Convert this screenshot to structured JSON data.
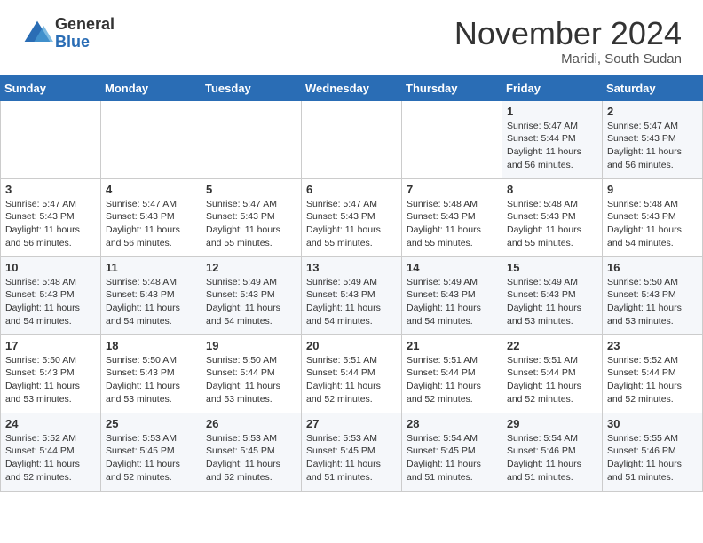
{
  "header": {
    "logo_general": "General",
    "logo_blue": "Blue",
    "month_title": "November 2024",
    "location": "Maridi, South Sudan"
  },
  "weekdays": [
    "Sunday",
    "Monday",
    "Tuesday",
    "Wednesday",
    "Thursday",
    "Friday",
    "Saturday"
  ],
  "weeks": [
    [
      {
        "day": "",
        "info": ""
      },
      {
        "day": "",
        "info": ""
      },
      {
        "day": "",
        "info": ""
      },
      {
        "day": "",
        "info": ""
      },
      {
        "day": "",
        "info": ""
      },
      {
        "day": "1",
        "info": "Sunrise: 5:47 AM\nSunset: 5:44 PM\nDaylight: 11 hours\nand 56 minutes."
      },
      {
        "day": "2",
        "info": "Sunrise: 5:47 AM\nSunset: 5:43 PM\nDaylight: 11 hours\nand 56 minutes."
      }
    ],
    [
      {
        "day": "3",
        "info": "Sunrise: 5:47 AM\nSunset: 5:43 PM\nDaylight: 11 hours\nand 56 minutes."
      },
      {
        "day": "4",
        "info": "Sunrise: 5:47 AM\nSunset: 5:43 PM\nDaylight: 11 hours\nand 56 minutes."
      },
      {
        "day": "5",
        "info": "Sunrise: 5:47 AM\nSunset: 5:43 PM\nDaylight: 11 hours\nand 55 minutes."
      },
      {
        "day": "6",
        "info": "Sunrise: 5:47 AM\nSunset: 5:43 PM\nDaylight: 11 hours\nand 55 minutes."
      },
      {
        "day": "7",
        "info": "Sunrise: 5:48 AM\nSunset: 5:43 PM\nDaylight: 11 hours\nand 55 minutes."
      },
      {
        "day": "8",
        "info": "Sunrise: 5:48 AM\nSunset: 5:43 PM\nDaylight: 11 hours\nand 55 minutes."
      },
      {
        "day": "9",
        "info": "Sunrise: 5:48 AM\nSunset: 5:43 PM\nDaylight: 11 hours\nand 54 minutes."
      }
    ],
    [
      {
        "day": "10",
        "info": "Sunrise: 5:48 AM\nSunset: 5:43 PM\nDaylight: 11 hours\nand 54 minutes."
      },
      {
        "day": "11",
        "info": "Sunrise: 5:48 AM\nSunset: 5:43 PM\nDaylight: 11 hours\nand 54 minutes."
      },
      {
        "day": "12",
        "info": "Sunrise: 5:49 AM\nSunset: 5:43 PM\nDaylight: 11 hours\nand 54 minutes."
      },
      {
        "day": "13",
        "info": "Sunrise: 5:49 AM\nSunset: 5:43 PM\nDaylight: 11 hours\nand 54 minutes."
      },
      {
        "day": "14",
        "info": "Sunrise: 5:49 AM\nSunset: 5:43 PM\nDaylight: 11 hours\nand 54 minutes."
      },
      {
        "day": "15",
        "info": "Sunrise: 5:49 AM\nSunset: 5:43 PM\nDaylight: 11 hours\nand 53 minutes."
      },
      {
        "day": "16",
        "info": "Sunrise: 5:50 AM\nSunset: 5:43 PM\nDaylight: 11 hours\nand 53 minutes."
      }
    ],
    [
      {
        "day": "17",
        "info": "Sunrise: 5:50 AM\nSunset: 5:43 PM\nDaylight: 11 hours\nand 53 minutes."
      },
      {
        "day": "18",
        "info": "Sunrise: 5:50 AM\nSunset: 5:43 PM\nDaylight: 11 hours\nand 53 minutes."
      },
      {
        "day": "19",
        "info": "Sunrise: 5:50 AM\nSunset: 5:44 PM\nDaylight: 11 hours\nand 53 minutes."
      },
      {
        "day": "20",
        "info": "Sunrise: 5:51 AM\nSunset: 5:44 PM\nDaylight: 11 hours\nand 52 minutes."
      },
      {
        "day": "21",
        "info": "Sunrise: 5:51 AM\nSunset: 5:44 PM\nDaylight: 11 hours\nand 52 minutes."
      },
      {
        "day": "22",
        "info": "Sunrise: 5:51 AM\nSunset: 5:44 PM\nDaylight: 11 hours\nand 52 minutes."
      },
      {
        "day": "23",
        "info": "Sunrise: 5:52 AM\nSunset: 5:44 PM\nDaylight: 11 hours\nand 52 minutes."
      }
    ],
    [
      {
        "day": "24",
        "info": "Sunrise: 5:52 AM\nSunset: 5:44 PM\nDaylight: 11 hours\nand 52 minutes."
      },
      {
        "day": "25",
        "info": "Sunrise: 5:53 AM\nSunset: 5:45 PM\nDaylight: 11 hours\nand 52 minutes."
      },
      {
        "day": "26",
        "info": "Sunrise: 5:53 AM\nSunset: 5:45 PM\nDaylight: 11 hours\nand 52 minutes."
      },
      {
        "day": "27",
        "info": "Sunrise: 5:53 AM\nSunset: 5:45 PM\nDaylight: 11 hours\nand 51 minutes."
      },
      {
        "day": "28",
        "info": "Sunrise: 5:54 AM\nSunset: 5:45 PM\nDaylight: 11 hours\nand 51 minutes."
      },
      {
        "day": "29",
        "info": "Sunrise: 5:54 AM\nSunset: 5:46 PM\nDaylight: 11 hours\nand 51 minutes."
      },
      {
        "day": "30",
        "info": "Sunrise: 5:55 AM\nSunset: 5:46 PM\nDaylight: 11 hours\nand 51 minutes."
      }
    ]
  ]
}
